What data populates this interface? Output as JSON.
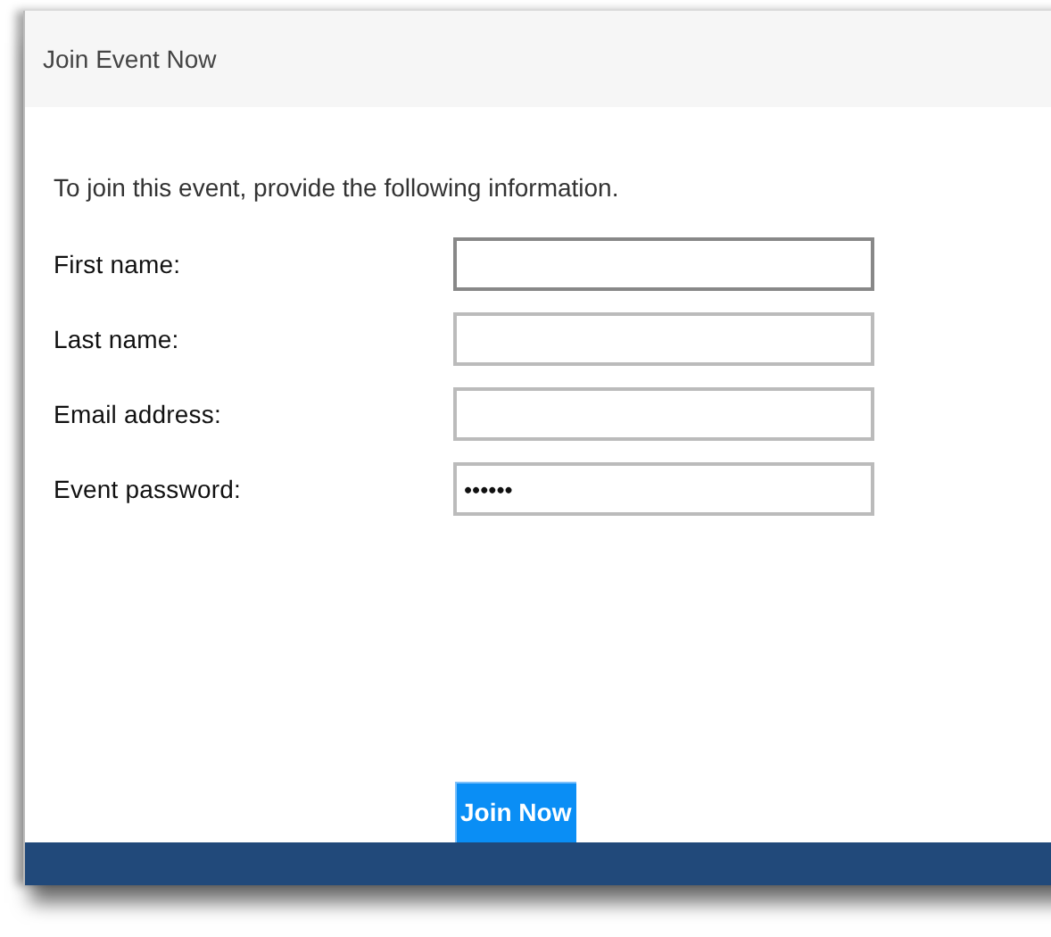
{
  "dialog": {
    "title": "Join Event Now"
  },
  "instructions": "To join this event, provide the following information.",
  "fields": [
    {
      "label": "First name:",
      "focused": true
    },
    {
      "label": "Last name:",
      "focused": false
    },
    {
      "label": "Email address:",
      "focused": false
    },
    {
      "label": "Event password:",
      "value": "••••••",
      "focused": false
    }
  ],
  "buttons": [
    {
      "label": "Join Now"
    }
  ]
}
